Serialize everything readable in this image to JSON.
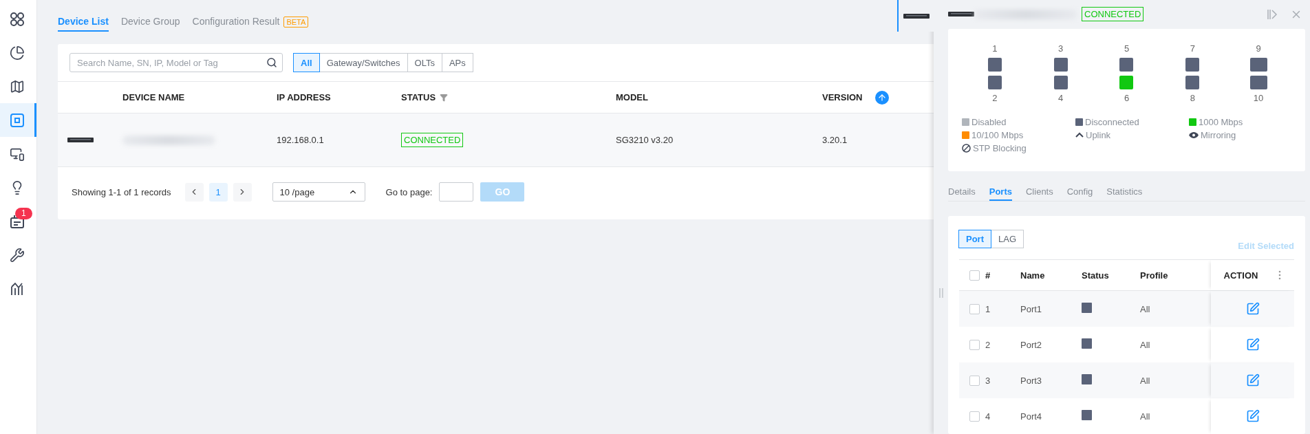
{
  "sidebar": {
    "items": [
      {
        "selected": false
      },
      {
        "selected": false
      },
      {
        "selected": false
      },
      {
        "selected": true
      },
      {
        "selected": false
      },
      {
        "selected": false
      },
      {
        "selected": false,
        "badge": "1"
      },
      {
        "selected": false
      },
      {
        "selected": false
      }
    ]
  },
  "tabs": [
    {
      "label": "Device List",
      "selected": true
    },
    {
      "label": "Device Group",
      "selected": false
    },
    {
      "label": "Configuration Result",
      "selected": false,
      "badge": "BETA"
    }
  ],
  "search": {
    "placeholder": "Search Name, SN, IP, Model or Tag"
  },
  "filters": [
    {
      "label": "All",
      "selected": true
    },
    {
      "label": "Gateway/Switches",
      "selected": false
    },
    {
      "label": "OLTs",
      "selected": false
    },
    {
      "label": "APs",
      "selected": false
    }
  ],
  "table": {
    "columns": [
      "DEVICE NAME",
      "IP ADDRESS",
      "STATUS",
      "MODEL",
      "VERSION"
    ],
    "rows": [
      {
        "ip": "192.168.0.1",
        "status": "CONNECTED",
        "model": "SG3210 v3.20",
        "version": "3.20.1"
      }
    ]
  },
  "pagination": {
    "summary": "Showing 1-1 of 1 records",
    "pages": [
      {
        "label": "1",
        "selected": true
      }
    ],
    "page_size": "10 /page",
    "goto_label": "Go to page:",
    "go_button": {
      "label": "GO",
      "disabled": true
    }
  },
  "drawer": {
    "status": "CONNECTED",
    "ports": [
      {
        "number": "1",
        "color": "#5a6379",
        "kind": "rj45"
      },
      {
        "number": "2",
        "color": "#5a6379",
        "kind": "rj45"
      },
      {
        "number": "3",
        "color": "#5a6379",
        "kind": "rj45"
      },
      {
        "number": "4",
        "color": "#5a6379",
        "kind": "rj45"
      },
      {
        "number": "5",
        "color": "#5a6379",
        "kind": "rj45"
      },
      {
        "number": "6",
        "color": "#11c811",
        "kind": "rj45"
      },
      {
        "number": "7",
        "color": "#5a6379",
        "kind": "rj45"
      },
      {
        "number": "8",
        "color": "#5a6379",
        "kind": "rj45"
      },
      {
        "number": "9",
        "color": "#5a6379",
        "kind": "sfp"
      },
      {
        "number": "10",
        "color": "#5a6379",
        "kind": "sfp"
      }
    ],
    "legend": [
      {
        "kind": "swatch",
        "color": "#b0b5bb",
        "label": "Disabled"
      },
      {
        "kind": "swatch",
        "color": "#5a6379",
        "label": "Disconnected"
      },
      {
        "kind": "swatch",
        "color": "#11c811",
        "label": "1000 Mbps"
      },
      {
        "kind": "swatch",
        "color": "#ff8c00",
        "label": "10/100 Mbps"
      },
      {
        "kind": "uplink",
        "label": "Uplink"
      },
      {
        "kind": "mirroring",
        "label": "Mirroring"
      },
      {
        "kind": "stp",
        "label": "STP Blocking"
      }
    ],
    "tabs": [
      {
        "label": "Details",
        "selected": false
      },
      {
        "label": "Ports",
        "selected": true
      },
      {
        "label": "Clients",
        "selected": false
      },
      {
        "label": "Config",
        "selected": false
      },
      {
        "label": "Statistics",
        "selected": false
      }
    ],
    "port_tabs": [
      {
        "label": "Port",
        "selected": true
      },
      {
        "label": "LAG",
        "selected": false
      }
    ],
    "edit_selected": {
      "label": "Edit Selected",
      "disabled": true
    },
    "all_checked": false,
    "columns": [
      "#",
      "Name",
      "Status",
      "Profile",
      "ACTION"
    ],
    "rows": [
      {
        "checked": false,
        "number": "1",
        "name": "Port1",
        "color": "#5a6379",
        "profile": "All"
      },
      {
        "checked": false,
        "number": "2",
        "name": "Port2",
        "color": "#5a6379",
        "profile": "All"
      },
      {
        "checked": false,
        "number": "3",
        "name": "Port3",
        "color": "#5a6379",
        "profile": "All"
      },
      {
        "checked": false,
        "number": "4",
        "name": "Port4",
        "color": "#5a6379",
        "profile": "All"
      }
    ]
  }
}
